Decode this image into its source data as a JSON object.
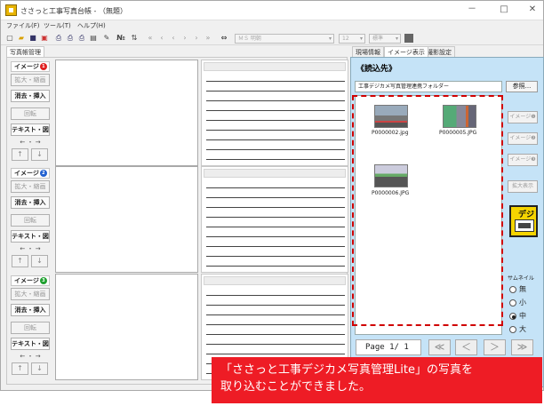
{
  "window": {
    "title": "ささっと工事写真台帳 - （無題）",
    "controls": [
      "－",
      "□",
      "✕"
    ]
  },
  "menu": [
    "ファイル(F)",
    "ツール(T)",
    "ヘルプ(H)"
  ],
  "toolbar": {
    "font_name": "ＭＳ 明朝",
    "font_size": "12",
    "font_style": "標準"
  },
  "left_tab": "写真帳管理",
  "blocks": [
    {
      "label": "イメージ",
      "badge": "1",
      "badge_color": "#e02020"
    },
    {
      "label": "イメージ",
      "badge": "2",
      "badge_color": "#2060d0"
    },
    {
      "label": "イメージ",
      "badge": "3",
      "badge_color": "#20a030"
    }
  ],
  "block_buttons": {
    "zoom": "拡大・縮画",
    "erase": "消去・挿入",
    "rotate": "回転",
    "text": "テキスト・図",
    "arrows": "← ・ →",
    "up": "↑",
    "down": "↓"
  },
  "right_tabs": [
    "現場情報",
    "イメージ表示",
    "撮影設定"
  ],
  "read_source": {
    "heading": "《読込先》",
    "folder": "工事デジカメ写真管理連携フォルダー",
    "browse": "参照..."
  },
  "thumbnails": [
    {
      "file": "P0000002.jpg"
    },
    {
      "file": "P0000005.JPG"
    },
    {
      "file": "P0000006.JPG"
    }
  ],
  "side_buttons": {
    "img1": "イメージ❶",
    "img2": "イメージ❷",
    "img3": "イメージ❸",
    "enlarge": "拡大表示",
    "deji": "デジ"
  },
  "thumb_size": {
    "label": "サムネイル",
    "options": [
      "無",
      "小",
      "中",
      "大"
    ],
    "selected": "中"
  },
  "pager": {
    "label": "Page 1/ 1",
    "first": "≪",
    "prev": "＜",
    "next": "＞",
    "last": "≫"
  },
  "banner": {
    "line1": "「ささっと工事デジカメ写真管理Lite」の写真を",
    "line2": "取り込むことができました。"
  }
}
